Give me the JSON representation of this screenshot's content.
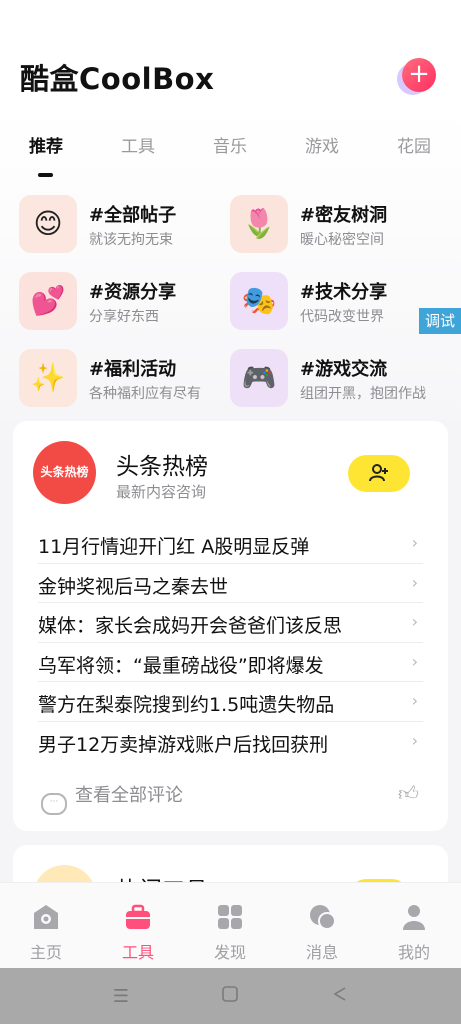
{
  "app": {
    "title": "酷盒CoolBox",
    "add_icon": "plus-icon"
  },
  "tabs": [
    {
      "label": "推荐",
      "active": true
    },
    {
      "label": "工具",
      "active": false
    },
    {
      "label": "音乐",
      "active": false
    },
    {
      "label": "游戏",
      "active": false
    },
    {
      "label": "花园",
      "active": false
    }
  ],
  "categories": [
    {
      "title": "#全部帖子",
      "subtitle": "就该无拘无束",
      "icon": "smiley-faces-icon"
    },
    {
      "title": "#密友树洞",
      "subtitle": "暖心秘密空间",
      "icon": "tulip-icon"
    },
    {
      "title": "#资源分享",
      "subtitle": "分享好东西",
      "icon": "hearts-icon"
    },
    {
      "title": "#技术分享",
      "subtitle": "代码改变世界",
      "icon": "theater-masks-icon"
    },
    {
      "title": "#福利活动",
      "subtitle": "各种福利应有尽有",
      "icon": "sparkles-icon"
    },
    {
      "title": "#游戏交流",
      "subtitle": "组团开黑，抱团作战",
      "icon": "gamepad-icon"
    }
  ],
  "debug_label": "调试",
  "hot": {
    "logo_text": "头条热榜",
    "title": "头条热榜",
    "subtitle": "最新内容咨询",
    "follow_icon": "add-user-icon",
    "items": [
      "11月行情迎开门红 A股明显反弹",
      "金钟奖视后马之秦去世",
      "媒体：家长会成妈开会爸爸们该反思",
      "乌军将领：“最重磅战役”即将爆发",
      "警方在梨泰院搜到约1.5吨遗失物品",
      "男子12万卖掉游戏账户后找回获刑"
    ],
    "view_all": "查看全部评论",
    "like_icon": "thumbs-up-icon"
  },
  "card2": {
    "title": "热门工具"
  },
  "tabbar": [
    {
      "label": "主页",
      "icon": "home-icon",
      "active": false
    },
    {
      "label": "工具",
      "icon": "toolbox-icon",
      "active": true
    },
    {
      "label": "发现",
      "icon": "grid-icon",
      "active": false
    },
    {
      "label": "消息",
      "icon": "chat-icon",
      "active": false
    },
    {
      "label": "我的",
      "icon": "person-icon",
      "active": false
    }
  ],
  "colors": {
    "accent": "#ff4f7a",
    "yellow": "#ffe533",
    "debug": "#3fa5d8"
  }
}
